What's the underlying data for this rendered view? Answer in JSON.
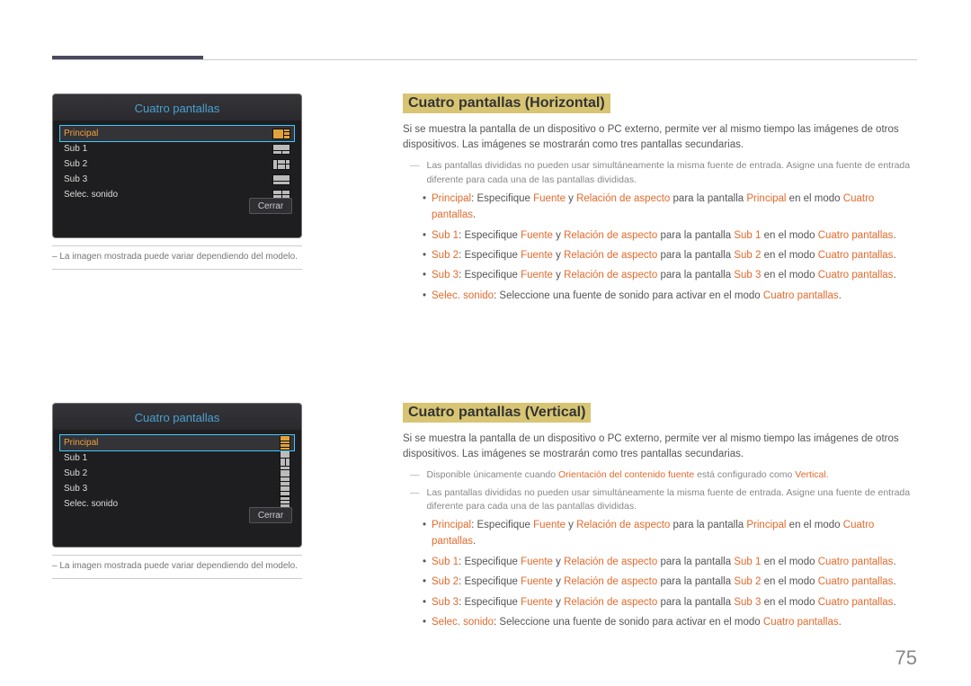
{
  "page_number": "75",
  "horizontal": {
    "osd_title": "Cuatro pantallas",
    "items": [
      "Principal",
      "Sub 1",
      "Sub 2",
      "Sub 3",
      "Selec. sonido"
    ],
    "close": "Cerrar",
    "note": "– La imagen mostrada puede variar dependiendo del modelo.",
    "heading": "Cuatro pantallas (Horizontal)",
    "intro": "Si se muestra la pantalla de un dispositivo o PC externo, permite ver al mismo tiempo las imágenes de otros dispositivos. Las imágenes se mostrarán como tres pantallas secundarias.",
    "dash1": "Las pantallas divididas no pueden usar simultáneamente la misma fuente de entrada. Asigne una fuente de entrada diferente para cada una de las pantallas divididas.",
    "bullets": {
      "b1": {
        "k": "Principal",
        "t1": ": Especifique ",
        "f": "Fuente",
        "y": " y ",
        "r": "Relación de aspecto",
        "t2": " para la pantalla ",
        "p": "Principal",
        "t3": " en el modo ",
        "m": "Cuatro pantallas",
        "t4": "."
      },
      "b2": {
        "k": "Sub 1",
        "t1": ": Especifique ",
        "f": "Fuente",
        "y": " y ",
        "r": "Relación de aspecto",
        "t2": " para la pantalla ",
        "p": "Sub 1",
        "t3": " en el modo ",
        "m": "Cuatro pantallas",
        "t4": "."
      },
      "b3": {
        "k": "Sub 2",
        "t1": ": Especifique ",
        "f": "Fuente",
        "y": " y ",
        "r": "Relación de aspecto",
        "t2": " para la pantalla ",
        "p": "Sub 2",
        "t3": " en el modo ",
        "m": "Cuatro pantallas",
        "t4": "."
      },
      "b4": {
        "k": "Sub 3",
        "t1": ": Especifique ",
        "f": "Fuente",
        "y": " y ",
        "r": "Relación de aspecto",
        "t2": " para la pantalla ",
        "p": "Sub 3",
        "t3": " en el modo ",
        "m": "Cuatro pantallas",
        "t4": "."
      },
      "b5": {
        "k": "Selec. sonido",
        "t": ": Seleccione una fuente de sonido para activar en el modo ",
        "m": "Cuatro pantallas",
        "t2": "."
      }
    }
  },
  "vertical": {
    "osd_title": "Cuatro pantallas",
    "items": [
      "Principal",
      "Sub 1",
      "Sub 2",
      "Sub 3",
      "Selec. sonido"
    ],
    "close": "Cerrar",
    "note": "– La imagen mostrada puede variar dependiendo del modelo.",
    "heading": "Cuatro pantallas (Vertical)",
    "intro": "Si se muestra la pantalla de un dispositivo o PC externo, permite ver al mismo tiempo las imágenes de otros dispositivos. Las imágenes se mostrarán como tres pantallas secundarias.",
    "dash0_a": "Disponible únicamente cuando ",
    "dash0_h1": "Orientación del contenido fuente",
    "dash0_b": " está configurado como ",
    "dash0_h2": "Vertical",
    "dash0_c": ".",
    "dash1": "Las pantallas divididas no pueden usar simultáneamente la misma fuente de entrada. Asigne una fuente de entrada diferente para cada una de las pantallas divididas.",
    "bullets": {
      "b1": {
        "k": "Principal",
        "t1": ": Especifique ",
        "f": "Fuente",
        "y": " y ",
        "r": "Relación de aspecto",
        "t2": " para la pantalla ",
        "p": "Principal",
        "t3": " en el modo ",
        "m": "Cuatro pantallas",
        "t4": "."
      },
      "b2": {
        "k": "Sub 1",
        "t1": ": Especifique ",
        "f": "Fuente",
        "y": " y ",
        "r": "Relación de aspecto",
        "t2": " para la pantalla ",
        "p": "Sub 1",
        "t3": " en el modo ",
        "m": "Cuatro pantallas",
        "t4": "."
      },
      "b3": {
        "k": "Sub 2",
        "t1": ": Especifique ",
        "f": "Fuente",
        "y": " y ",
        "r": "Relación de aspecto",
        "t2": " para la pantalla ",
        "p": "Sub 2",
        "t3": " en el modo ",
        "m": "Cuatro pantallas",
        "t4": "."
      },
      "b4": {
        "k": "Sub 3",
        "t1": ": Especifique ",
        "f": "Fuente",
        "y": " y ",
        "r": "Relación de aspecto",
        "t2": " para la pantalla ",
        "p": "Sub 3",
        "t3": " en el modo ",
        "m": "Cuatro pantallas",
        "t4": "."
      },
      "b5": {
        "k": "Selec. sonido",
        "t": ": Seleccione una fuente de sonido para activar en el modo ",
        "m": "Cuatro pantallas",
        "t2": "."
      }
    }
  }
}
